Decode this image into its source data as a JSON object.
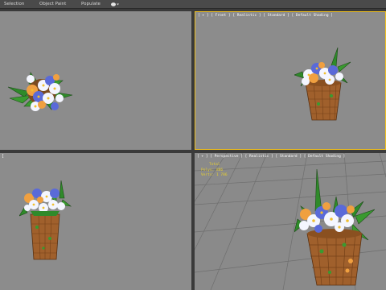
{
  "ribbon": {
    "tabs": [
      "Selection",
      "Object Paint",
      "Populate"
    ],
    "dropdown_icon": "teapot-dropdown-icon"
  },
  "viewports": {
    "top": {
      "label": ""
    },
    "front": {
      "label": "[ + ] [ Front ] [ Realistic ] [ Standard ] [ Default Shading ]"
    },
    "left": {
      "label": "["
    },
    "persp": {
      "label": "[ + ] [ Perspective ] [ Realistic ] [ Standard ] [ Default Shading ]",
      "stats": {
        "title": "Total",
        "polys_label": "Polys:",
        "polys_value": "886",
        "verts_label": "Verts:",
        "verts_value": "1 786"
      }
    }
  },
  "colors": {
    "viewport_bg": "#8c8c8c",
    "active_border": "#f0c020",
    "stats_text": "#e8d030",
    "pot": "#a0602c",
    "leaf": "#2f8a2a",
    "flower_white": "#f4f6ff",
    "flower_blue": "#5a6ad8",
    "flower_orange": "#f0a040"
  }
}
